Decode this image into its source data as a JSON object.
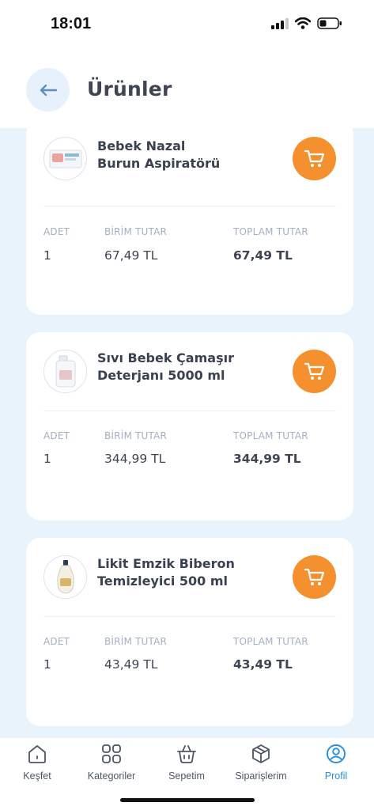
{
  "status_bar": {
    "time": "18:01"
  },
  "header": {
    "title": "Ürünler",
    "back_icon": "arrow-left-icon"
  },
  "columns": {
    "qty": "ADET",
    "unit": "BİRİM TUTAR",
    "total": "TOPLAM TUTAR"
  },
  "products": [
    {
      "name_line1": "Bebek Nazal",
      "name_line2": "Burun Aspiratörü",
      "qty": "1",
      "unit_price": "67,49 TL",
      "total_price": "67,49 TL"
    },
    {
      "name_line1": "Sıvı Bebek Çamaşır",
      "name_line2": "Deterjanı 5000 ml",
      "qty": "1",
      "unit_price": "344,99 TL",
      "total_price": "344,99 TL"
    },
    {
      "name_line1": "Likit Emzik Biberon",
      "name_line2": "Temizleyici 500 ml",
      "qty": "1",
      "unit_price": "43,49 TL",
      "total_price": "43,49 TL"
    }
  ],
  "tabbar": {
    "items": [
      {
        "label": "Keşfet",
        "icon": "home-icon"
      },
      {
        "label": "Kategoriler",
        "icon": "grid-icon"
      },
      {
        "label": "Sepetim",
        "icon": "basket-icon"
      },
      {
        "label": "Siparişlerim",
        "icon": "package-icon"
      },
      {
        "label": "Profil",
        "icon": "user-icon"
      }
    ],
    "active": "Profil"
  },
  "colors": {
    "accent": "#f4912e",
    "active_tab": "#2a8fd8",
    "background": "#e8f3fc"
  }
}
